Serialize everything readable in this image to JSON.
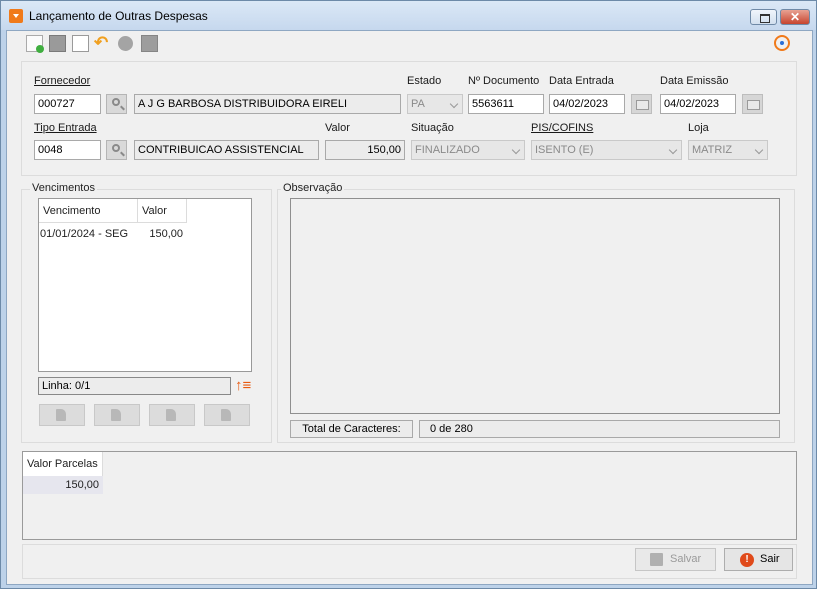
{
  "window": {
    "title": "Lançamento de Outras Despesas"
  },
  "labels": {
    "fornecedor": "Fornecedor",
    "estado": "Estado",
    "n_documento": "Nº Documento",
    "data_entrada": "Data Entrada",
    "data_emissao": "Data Emissão",
    "tipo_entrada": "Tipo Entrada",
    "valor": "Valor",
    "situacao": "Situação",
    "pis_cofins": "PIS/COFINS",
    "loja": "Loja"
  },
  "fields": {
    "fornecedor_code": "000727",
    "fornecedor_name": "A J G BARBOSA DISTRIBUIDORA EIRELI",
    "estado": "PA",
    "n_documento": "5563611",
    "data_entrada": "04/02/2023",
    "data_emissao": "04/02/2023",
    "tipo_entrada_code": "0048",
    "tipo_entrada_name": "CONTRIBUICAO ASSISTENCIAL",
    "valor": "150,00",
    "situacao": "FINALIZADO",
    "pis_cofins": "ISENTO (E)",
    "loja": "MATRIZ"
  },
  "vencimentos": {
    "title": "Vencimentos",
    "columns": [
      "Vencimento",
      "Valor"
    ],
    "rows": [
      {
        "vencimento": "01/01/2024 - SEG",
        "valor": "150,00"
      }
    ],
    "linha": "Linha: 0/1"
  },
  "observacao": {
    "title": "Observação",
    "total_label": "Total de Caracteres:",
    "total_value": "0 de 280"
  },
  "parcelas": {
    "column": "Valor Parcelas",
    "value": "150,00"
  },
  "footer": {
    "salvar": "Salvar",
    "sair": "Sair"
  },
  "icons": [
    "new-document-icon",
    "save-icon",
    "copy-icon",
    "undo-icon",
    "cancel-icon",
    "print-icon",
    "timer-icon",
    "magnifier-icon",
    "calendar-icon",
    "sort-order-icon"
  ]
}
